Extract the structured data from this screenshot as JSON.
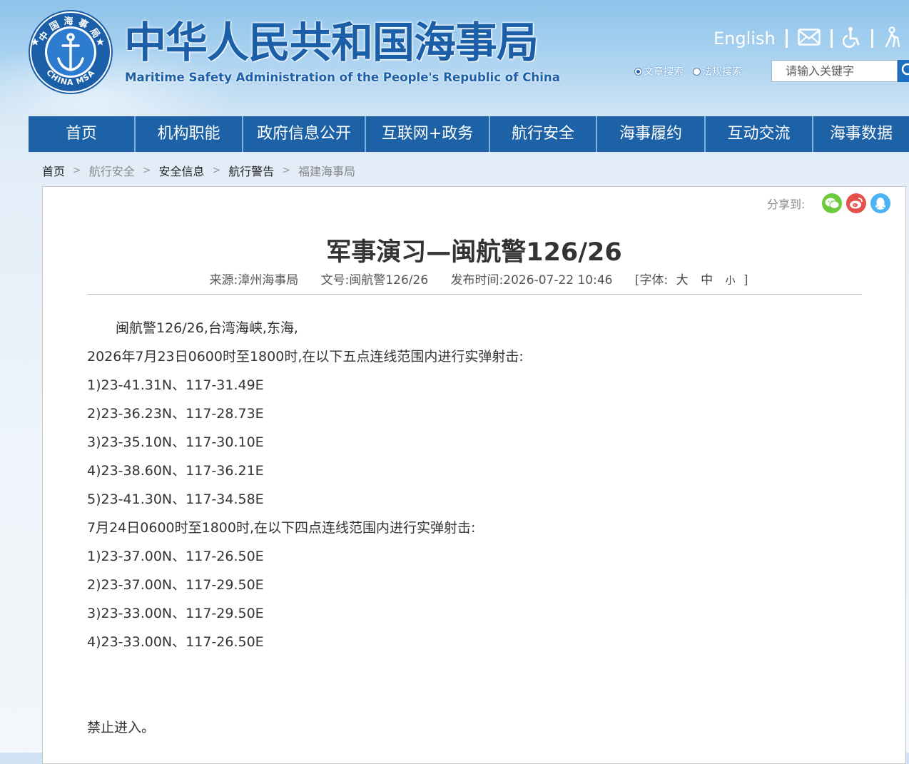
{
  "colors": {
    "brand_blue": "#1b5fa9",
    "nav_bg": "#1d62a6",
    "wechat": "#6ccb3c",
    "weibo": "#e4504b",
    "qq": "#4cb3f5"
  },
  "header": {
    "logo_text_top": "中国海事局",
    "logo_text_bottom": "CHINA MSA",
    "title": "中华人民共和国海事局",
    "subtitle": "Maritime Safety Administration of the People's Republic of China",
    "links": {
      "english": "English",
      "email_icon": "envelope-icon",
      "accessibility_icon": "wheelchair-icon",
      "elder_icon": "elderly-care-icon"
    },
    "search": {
      "options": [
        {
          "label": "文章搜索",
          "checked": true
        },
        {
          "label": "法规搜索",
          "checked": false
        }
      ],
      "placeholder": "请输入关键字",
      "button_icon": "search-icon"
    }
  },
  "nav": {
    "items": [
      {
        "label": "首页"
      },
      {
        "label": "机构职能"
      },
      {
        "label": "政府信息公开"
      },
      {
        "label": "互联网+政务"
      },
      {
        "label": "航行安全"
      },
      {
        "label": "海事履约"
      },
      {
        "label": "互动交流"
      },
      {
        "label": "海事数据"
      }
    ]
  },
  "breadcrumb": {
    "items": [
      {
        "label": "首页"
      },
      {
        "label": "航行安全"
      },
      {
        "label": "安全信息"
      },
      {
        "label": "航行警告"
      },
      {
        "label": "福建海事局"
      }
    ],
    "separator": ">"
  },
  "share": {
    "label": "分享到:",
    "icons": [
      "wechat-icon",
      "weibo-icon",
      "qq-icon"
    ]
  },
  "article": {
    "title": "军事演习—闽航警126/26",
    "meta": {
      "source": "来源:漳州海事局",
      "doc_no": "文号:闽航警126/26",
      "published": "发布时间:2026-07-22 10:46",
      "font_label": "[字体:",
      "font_large": "大",
      "font_medium": "中",
      "font_small": "小",
      "font_close": "]"
    },
    "paragraphs": {
      "p0": "闽航警126/26,台湾海峡,东海,",
      "p1": "2026年7月23日0600时至1800时,在以下五点连线范围内进行实弹射击:",
      "p2": "1)23-41.31N、117-31.49E",
      "p3": "2)23-36.23N、117-28.73E",
      "p4": "3)23-35.10N、117-30.10E",
      "p5": "4)23-38.60N、117-36.21E",
      "p6": "5)23-41.30N、117-34.58E",
      "p7": "7月24日0600时至1800时,在以下四点连线范围内进行实弹射击:",
      "p8": "1)23-37.00N、117-26.50E",
      "p9": "2)23-37.00N、117-29.50E",
      "p10": "3)23-33.00N、117-29.50E",
      "p11": "4)23-33.00N、117-26.50E",
      "p12": "禁止进入。"
    }
  }
}
